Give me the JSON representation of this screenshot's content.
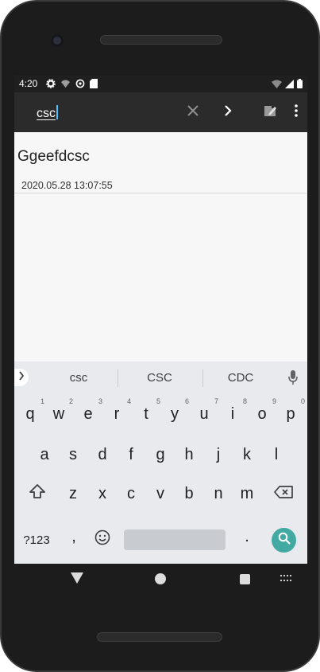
{
  "status_bar": {
    "time": "4:20"
  },
  "app_bar": {
    "search_query": "csc"
  },
  "note": {
    "title": "Ggeefdcsc",
    "date": "2020.05.28 13:07:55"
  },
  "keyboard": {
    "suggestions": [
      "csc",
      "CSC",
      "CDC"
    ],
    "row1": [
      {
        "key": "q",
        "hint": "1"
      },
      {
        "key": "w",
        "hint": "2"
      },
      {
        "key": "e",
        "hint": "3"
      },
      {
        "key": "r",
        "hint": "4"
      },
      {
        "key": "t",
        "hint": "5"
      },
      {
        "key": "y",
        "hint": "6"
      },
      {
        "key": "u",
        "hint": "7"
      },
      {
        "key": "i",
        "hint": "8"
      },
      {
        "key": "o",
        "hint": "9"
      },
      {
        "key": "p",
        "hint": "0"
      }
    ],
    "row2": [
      "a",
      "s",
      "d",
      "f",
      "g",
      "h",
      "j",
      "k",
      "l"
    ],
    "row3": [
      "z",
      "x",
      "c",
      "v",
      "b",
      "n",
      "m"
    ],
    "symbols_label": "?123",
    "comma": ",",
    "period": "."
  },
  "colors": {
    "accent": "#43a9a3",
    "app_bar": "#2b2b2b",
    "status_bar": "#1f1f1f",
    "keyboard_bg": "#e8eaed",
    "content_bg": "#f7f7f7"
  }
}
